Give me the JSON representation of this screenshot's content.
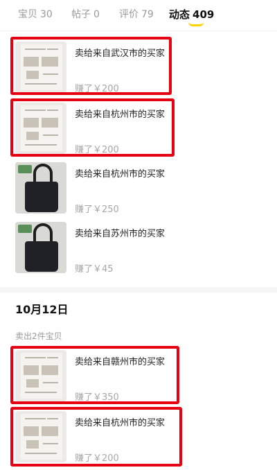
{
  "tabs": [
    {
      "label": "宝贝",
      "count": "30"
    },
    {
      "label": "帖子",
      "count": "0"
    },
    {
      "label": "评价",
      "count": "79"
    },
    {
      "label": "动态",
      "count": "409"
    }
  ],
  "items_top": [
    {
      "title": "卖给来自武汉市的买家",
      "earned": "赚了￥200",
      "thumb_icon": "document-photo-icon"
    },
    {
      "title": "卖给来自杭州市的买家",
      "earned": "赚了￥200",
      "thumb_icon": "document-photo-icon"
    },
    {
      "title": "卖给来自杭州市的买家",
      "earned": "赚了￥250",
      "thumb_icon": "black-tote-bag-icon"
    },
    {
      "title": "卖给来自苏州市的买家",
      "earned": "赚了￥45",
      "thumb_icon": "black-tote-bag-icon"
    }
  ],
  "section": {
    "date": "10月12日",
    "summary": "卖出2件宝贝"
  },
  "items_bottom": [
    {
      "title": "卖给来自赣州市的买家",
      "earned": "赚了￥350",
      "thumb_icon": "document-photo-icon"
    },
    {
      "title": "卖给来自杭州市的买家",
      "earned": "赚了￥200",
      "thumb_icon": "document-photo-icon"
    }
  ],
  "colors": {
    "highlight_box": "#e60012",
    "tab_indicator": "#ffd200",
    "muted_text": "#a6a6a6"
  }
}
